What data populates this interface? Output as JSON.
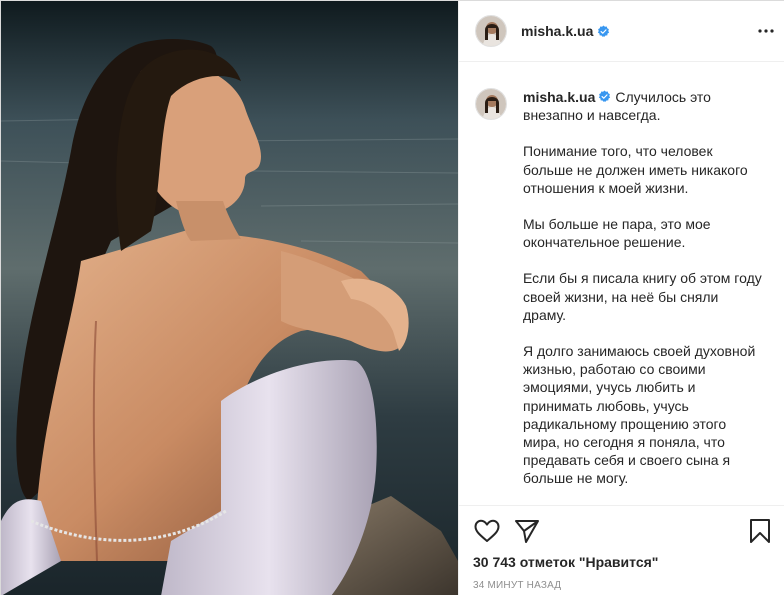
{
  "post": {
    "username": "misha.k.ua",
    "verified": true,
    "caption": {
      "username": "misha.k.ua",
      "paragraphs": [
        "Случилось это внезапно и навсегда.",
        "Понимание того, что человек больше не должен иметь никакого отношения к моей жизни.",
        "Мы больше не пара, это мое окончательное решение.",
        "Если бы я писала книгу об этом году своей жизни, на неё бы сняли драму.",
        "Я долго занимаюсь своей духовной жизнью, работаю со своими эмоциями, учусь любить и принимать любовь, учусь радикальному прощению этого мира, но сегодня я поняла, что предавать себя и своего сына я больше не могу."
      ]
    },
    "likes_text": "30 743 отметок \"Нравится\"",
    "time_text": "34 МИНУТ НАЗАД"
  },
  "icons": {
    "more": "more-options-icon",
    "like": "heart-icon",
    "share": "paper-plane-icon",
    "save": "bookmark-icon",
    "verified": "verified-badge-icon"
  },
  "colors": {
    "verified": "#3897f0",
    "text": "#262626",
    "muted": "#8e8e8e",
    "border": "#efefef"
  }
}
